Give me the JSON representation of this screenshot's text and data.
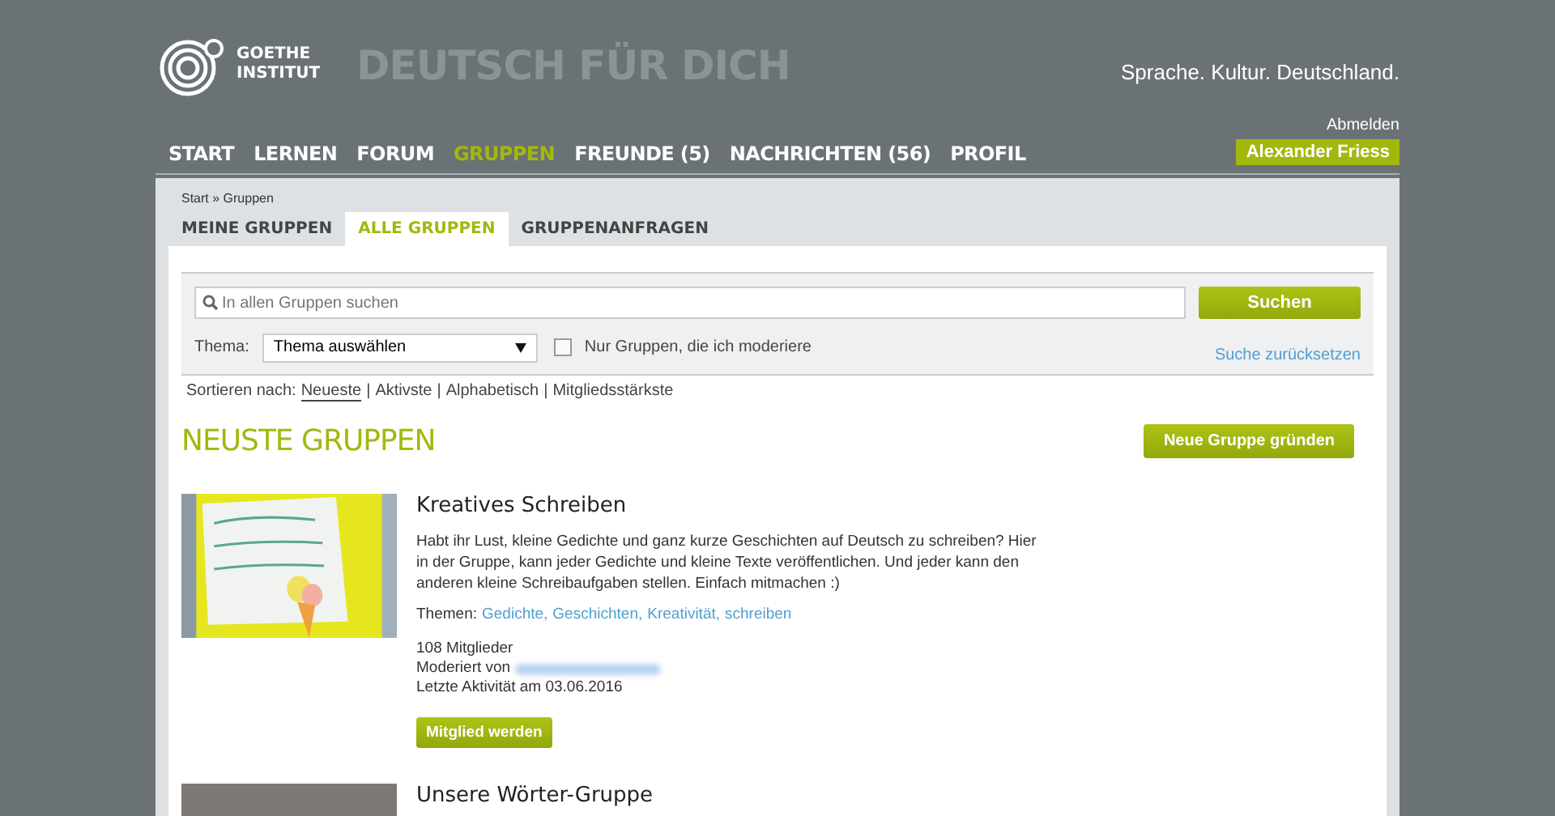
{
  "header": {
    "logo_text": "GOETHE INSTITUT",
    "site_title": "DEUTSCH FÜR DICH",
    "tagline": "Sprache. Kultur. Deutschland.",
    "logout": "Abmelden",
    "user": "Alexander Friess"
  },
  "nav": [
    {
      "label": "START",
      "selected": false
    },
    {
      "label": "LERNEN",
      "selected": false
    },
    {
      "label": "FORUM",
      "selected": false
    },
    {
      "label": "GRUPPEN",
      "selected": true
    },
    {
      "label": "FREUNDE (5)",
      "selected": false
    },
    {
      "label": "NACHRICHTEN (56)",
      "selected": false
    },
    {
      "label": "PROFIL",
      "selected": false
    }
  ],
  "breadcrumb": "Start » Gruppen",
  "tabs": [
    {
      "label": "MEINE GRUPPEN",
      "selected": false
    },
    {
      "label": "ALLE GRUPPEN",
      "selected": true
    },
    {
      "label": "GRUPPENANFRAGEN",
      "selected": false
    }
  ],
  "search": {
    "placeholder": "In allen Gruppen suchen",
    "button": "Suchen",
    "topic_label": "Thema:",
    "topic_value": "Thema auswählen",
    "moderated_only": {
      "label": "Nur Gruppen, die ich moderiere",
      "checked": false
    },
    "reset": "Suche zurücksetzen"
  },
  "sort": {
    "label": "Sortieren nach:",
    "separator": "|",
    "options": [
      {
        "label": "Neueste",
        "selected": true
      },
      {
        "label": "Aktivste",
        "selected": false
      },
      {
        "label": "Alphabetisch",
        "selected": false
      },
      {
        "label": "Mitgliedsstärkste",
        "selected": false
      }
    ]
  },
  "section_title": "NEUSTE GRUPPEN",
  "new_group_button": "Neue Gruppe gründen",
  "groups": [
    {
      "title": "Kreatives Schreiben",
      "description": "Habt ihr Lust, kleine Gedichte und ganz kurze Geschichten auf Deutsch zu schreiben? Hier in der Gruppe, kann jeder Gedichte und kleine Texte veröffentlichen. Und jeder kann den anderen kleine Schreibaufgaben stellen. Einfach mitmachen :)",
      "topics_label": "Themen:",
      "topics": [
        "Gedichte,",
        "Geschichten,",
        "Kreativität,",
        "schreiben"
      ],
      "members": "108 Mitglieder",
      "moderated_by": "Moderiert von",
      "last_activity": "Letzte Aktivität am 03.06.2016",
      "join_button": "Mitglied werden"
    },
    {
      "title": "Unsere Wörter-Gruppe"
    }
  ]
}
